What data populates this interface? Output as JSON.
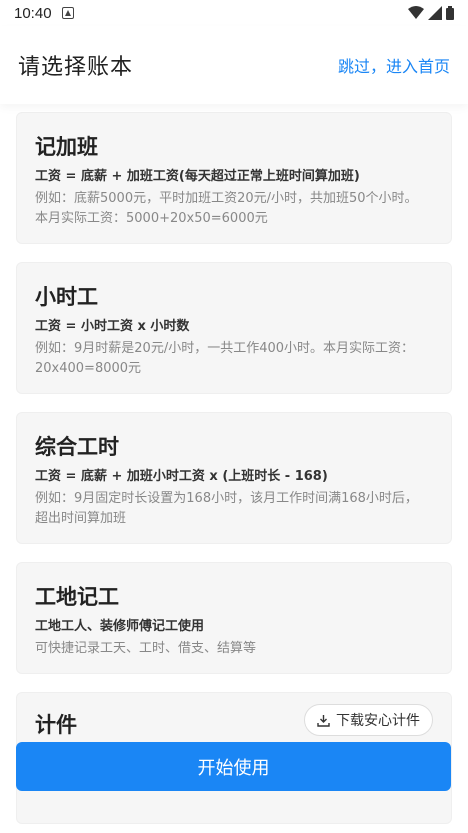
{
  "status_bar": {
    "time": "10:40"
  },
  "header": {
    "title": "请选择账本",
    "skip_label": "跳过，进入首页"
  },
  "cards": [
    {
      "title": "记加班",
      "formula": "工资 = 底薪 + 加班工资(每天超过正常上班时间算加班)",
      "desc_lines": [
        "例如：底薪5000元，平时加班工资20元/小时，共加班50个小时。",
        "本月实际工资：5000+20x50=6000元"
      ]
    },
    {
      "title": "小时工",
      "formula": "工资 = 小时工资 x 小时数",
      "desc_lines": [
        "例如：9月时薪是20元/小时，一共工作400小时。本月实际工资：",
        "20x400=8000元"
      ]
    },
    {
      "title": "综合工时",
      "formula": "工资 = 底薪 + 加班小时工资 x (上班时长 - 168)",
      "desc_lines": [
        "例如：9月固定时长设置为168小时，该月工作时间满168小时后，",
        "超出时间算加班"
      ]
    },
    {
      "title": "工地记工",
      "formula": "工地工人、装修师傅记工使用",
      "desc_lines": [
        "可快捷记录工天、工时、借支、结算等"
      ]
    },
    {
      "title": "计件",
      "download_label": "下载安心计件"
    }
  ],
  "start_button_label": "开始使用",
  "icons": [
    "wifi-icon",
    "signal-icon",
    "battery-icon",
    "download-icon"
  ]
}
